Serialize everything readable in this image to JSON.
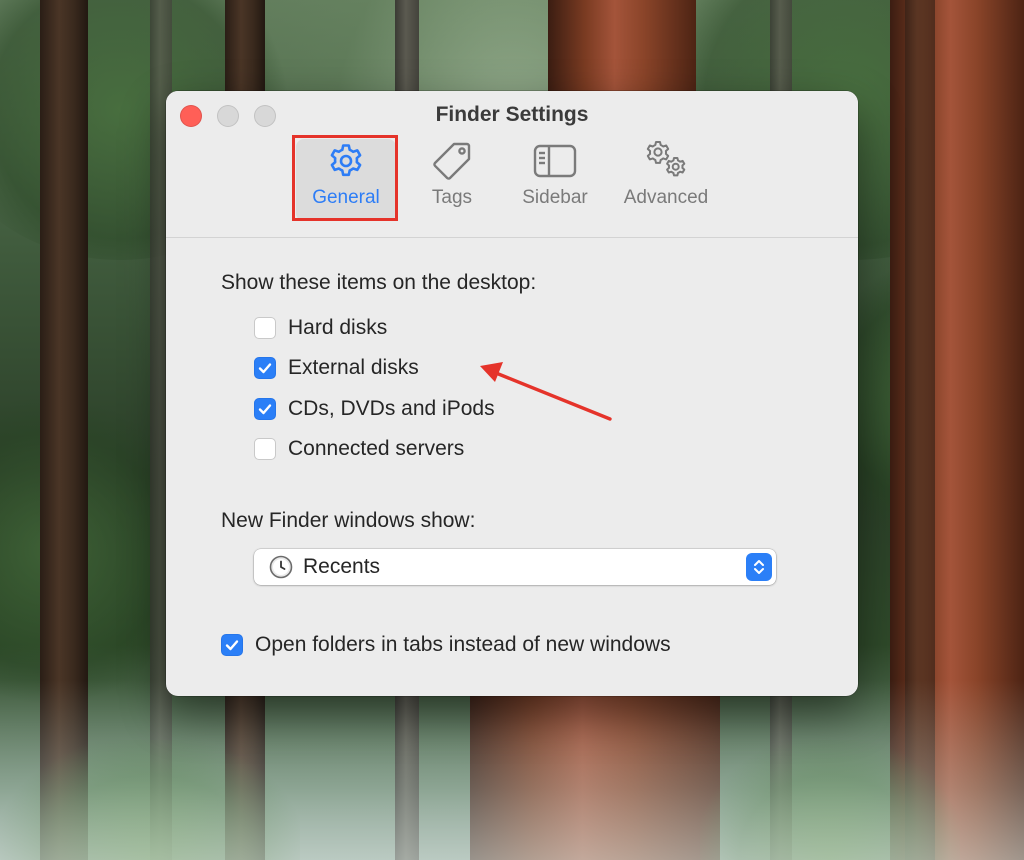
{
  "window": {
    "title": "Finder Settings"
  },
  "tabs": [
    {
      "label": "General",
      "icon": "gear-icon",
      "selected": true
    },
    {
      "label": "Tags",
      "icon": "tag-icon",
      "selected": false
    },
    {
      "label": "Sidebar",
      "icon": "sidebar-icon",
      "selected": false
    },
    {
      "label": "Advanced",
      "icon": "gears-icon",
      "selected": false
    }
  ],
  "desktop_items": {
    "heading": "Show these items on the desktop:",
    "items": [
      {
        "label": "Hard disks",
        "checked": false
      },
      {
        "label": "External disks",
        "checked": true
      },
      {
        "label": "CDs, DVDs and iPods",
        "checked": true
      },
      {
        "label": "Connected servers",
        "checked": false
      }
    ]
  },
  "new_windows": {
    "heading": "New Finder windows show:",
    "selected": "Recents",
    "icon": "clock-icon"
  },
  "open_in_tabs": {
    "label": "Open folders in tabs instead of new windows",
    "checked": true
  },
  "colors": {
    "accent": "#2b7ff7",
    "close_button": "#ff5f57",
    "annotation": "#e5332a",
    "window_bg": "#ececec"
  }
}
